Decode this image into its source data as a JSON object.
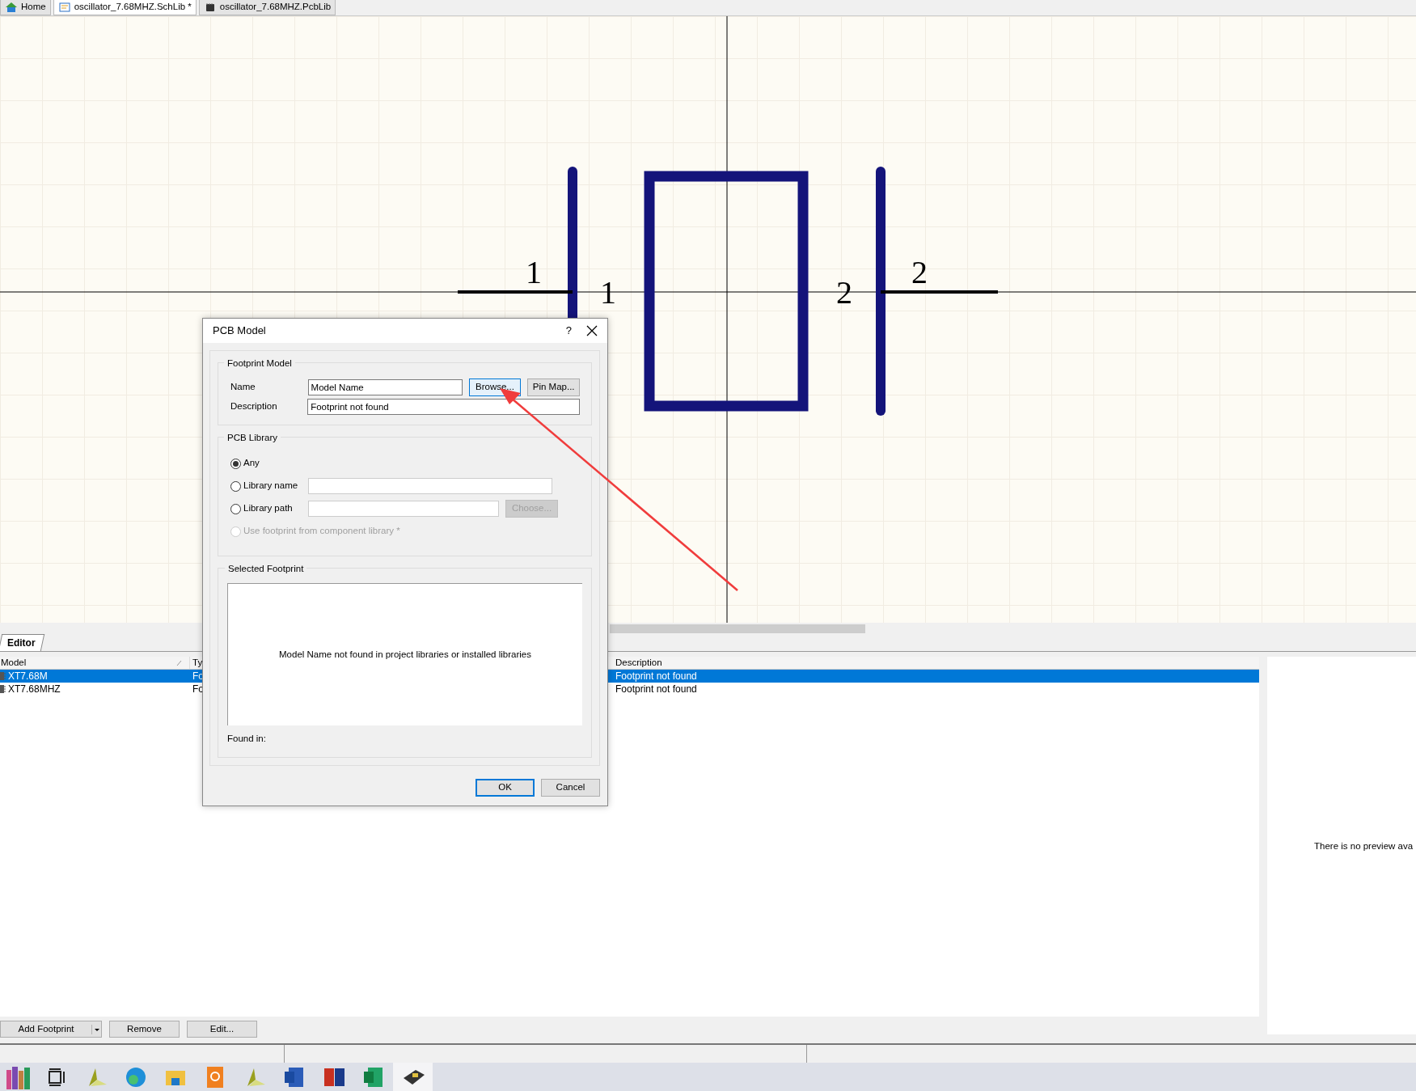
{
  "tabs": [
    {
      "label": "Home",
      "selected": false
    },
    {
      "label": "oscillator_7.68MHZ.SchLib *",
      "selected": true
    },
    {
      "label": "oscillator_7.68MHZ.PcbLib",
      "selected": false
    }
  ],
  "schematic": {
    "pins": [
      {
        "designator": "1",
        "name": "1"
      },
      {
        "designator": "2",
        "name": "2"
      }
    ]
  },
  "panel": {
    "tab": "Editor",
    "columns": [
      "Model",
      "Ty",
      "Description"
    ],
    "rows": [
      {
        "cells": [
          "XT7.68M",
          "Fo",
          "Footprint not found"
        ],
        "selected": true
      },
      {
        "cells": [
          "XT7.68MHZ",
          "Fo",
          "Footprint not found"
        ],
        "selected": false
      }
    ],
    "preview_text": "There is no preview ava",
    "buttons": [
      {
        "label": "Add Footprint",
        "kind": "split"
      },
      {
        "label": "Remove",
        "kind": "plain"
      },
      {
        "label": "Edit...",
        "kind": "plain"
      }
    ]
  },
  "dialog": {
    "title": "PCB Model",
    "help": "?",
    "footprint_model": {
      "legend": "Footprint Model",
      "name_label": "Name",
      "name_value": "Model Name",
      "description_label": "Description",
      "description_value": "Footprint not found",
      "buttons": [
        {
          "label": "Browse...",
          "focused": true
        },
        {
          "label": "Pin Map...",
          "focused": false
        }
      ]
    },
    "pcb_library": {
      "legend": "PCB Library",
      "options": [
        {
          "label": "Any",
          "selected": true,
          "disabled": false,
          "kind": "plain"
        },
        {
          "label": "Library name",
          "selected": false,
          "disabled": false,
          "kind": "field"
        },
        {
          "label": "Library path",
          "selected": false,
          "disabled": false,
          "kind": "field_button",
          "button": {
            "label": "Choose...",
            "disabled": true
          }
        },
        {
          "label": "Use footprint from component library *",
          "selected": false,
          "disabled": true,
          "kind": "plain"
        }
      ]
    },
    "selected_footprint": {
      "legend": "Selected Footprint",
      "message": "Model Name not found in project libraries or installed libraries",
      "found_in": "Found in:"
    },
    "buttons": [
      {
        "label": "OK",
        "default": true
      },
      {
        "label": "Cancel",
        "default": false
      }
    ]
  },
  "taskbar": [
    {
      "selected": false
    },
    {
      "selected": false
    },
    {
      "selected": false
    },
    {
      "selected": false
    },
    {
      "selected": false
    },
    {
      "selected": false
    },
    {
      "selected": false
    },
    {
      "selected": false
    },
    {
      "selected": false
    },
    {
      "selected": false
    },
    {
      "selected": true
    }
  ]
}
